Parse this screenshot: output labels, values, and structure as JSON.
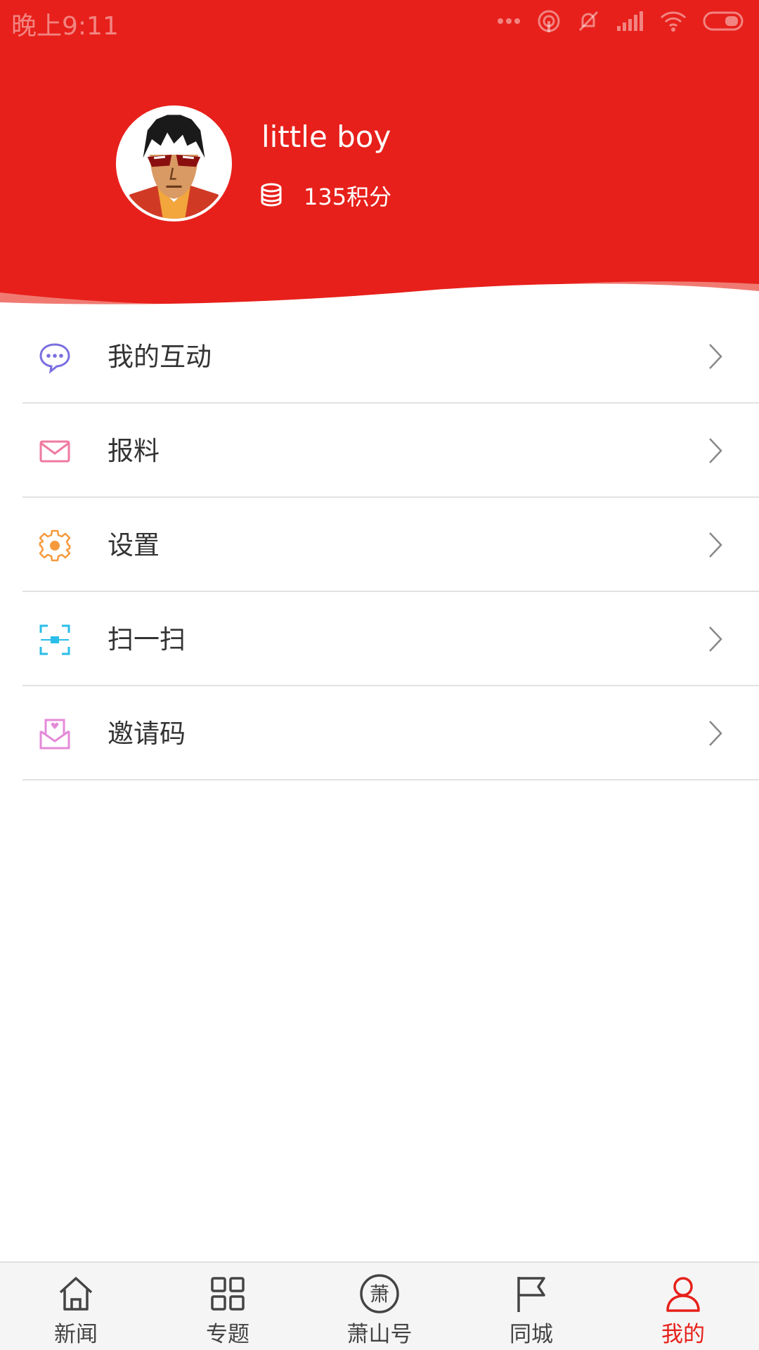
{
  "status_bar": {
    "time": "晚上9:11"
  },
  "profile": {
    "username": "little boy",
    "points": "135积分"
  },
  "menu": {
    "items": [
      {
        "label": "我的互动",
        "icon": "chat-bubble-icon",
        "color": "#7b6fe0"
      },
      {
        "label": "报料",
        "icon": "envelope-icon",
        "color": "#f07aa0"
      },
      {
        "label": "设置",
        "icon": "gear-icon",
        "color": "#f59a3c"
      },
      {
        "label": "扫一扫",
        "icon": "scan-icon",
        "color": "#2bbde8"
      },
      {
        "label": "邀请码",
        "icon": "invite-envelope-icon",
        "color": "#e48ad8"
      }
    ]
  },
  "tabbar": {
    "tabs": [
      {
        "label": "新闻",
        "icon": "home-icon",
        "active": false
      },
      {
        "label": "专题",
        "icon": "grid-icon",
        "active": false
      },
      {
        "label": "萧山号",
        "icon": "xiao-seal-icon",
        "active": false,
        "seal_char": "萧"
      },
      {
        "label": "同城",
        "icon": "flag-icon",
        "active": false
      },
      {
        "label": "我的",
        "icon": "person-icon",
        "active": true
      }
    ]
  },
  "colors": {
    "brand_red": "#e7201b",
    "text_dark": "#333333",
    "divider": "#e2e2e2"
  }
}
